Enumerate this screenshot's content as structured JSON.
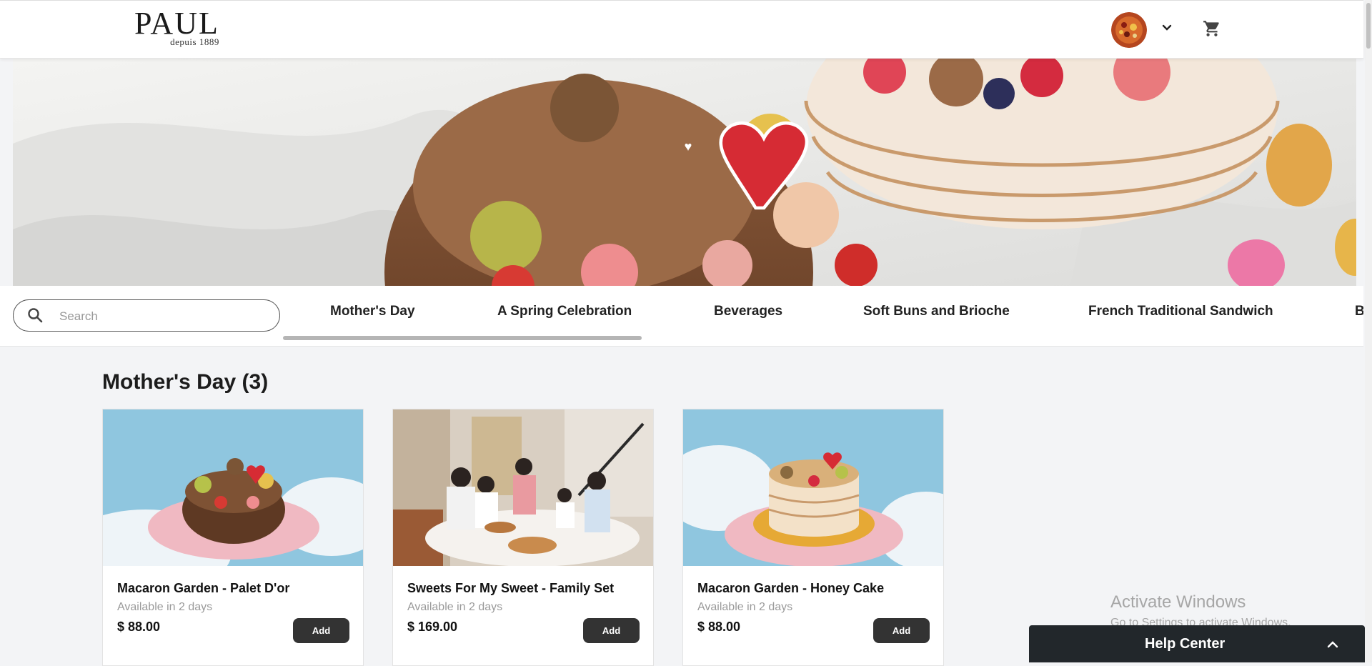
{
  "header": {
    "brand": "PAUL",
    "brand_sub": "depuis 1889",
    "icons": {
      "account_menu": "chevron-down-icon",
      "cart": "cart-icon"
    }
  },
  "search": {
    "placeholder": "Search",
    "value": ""
  },
  "categories": [
    "Mother's Day",
    "A Spring Celebration",
    "Beverages",
    "Soft Buns and Brioche",
    "French Traditional Sandwich",
    "B"
  ],
  "section": {
    "title": "Mother's Day (3)"
  },
  "products": [
    {
      "name": "Macaron Garden - Palet D'or",
      "availability": "Available in 2 days",
      "price": "$ 88.00",
      "button": "Add"
    },
    {
      "name": "Sweets For My Sweet - Family Set",
      "availability": "Available in 2 days",
      "price": "$ 169.00",
      "button": "Add"
    },
    {
      "name": "Macaron Garden - Honey Cake",
      "availability": "Available in 2 days",
      "price": "$ 88.00",
      "button": "Add"
    }
  ],
  "windows_watermark": {
    "line1": "Activate Windows",
    "line2": "Go to Settings to activate Windows."
  },
  "help_center": {
    "label": "Help Center"
  },
  "colors": {
    "button_bg": "#333333",
    "help_bg": "#22272b",
    "page_bg": "#f3f4f6"
  }
}
